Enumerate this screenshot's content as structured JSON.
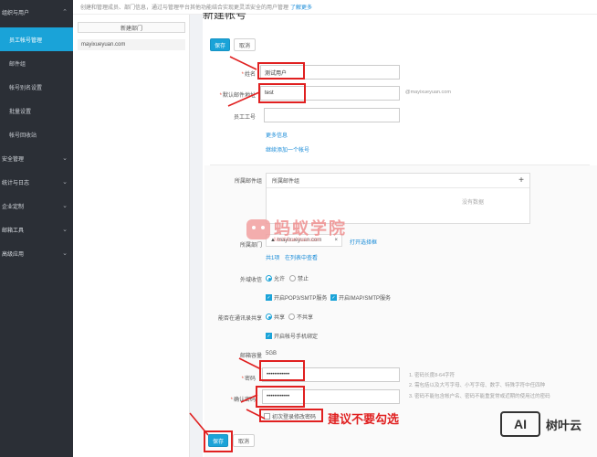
{
  "sidebar": {
    "groups": [
      {
        "label": "组织与用户"
      },
      {
        "label": "安全管理"
      },
      {
        "label": "统计与日志"
      },
      {
        "label": "企业定制"
      },
      {
        "label": "邮箱工具"
      },
      {
        "label": "高级应用"
      }
    ],
    "items": [
      {
        "label": "员工帐号管理",
        "active": true
      },
      {
        "label": "邮件组"
      },
      {
        "label": "帐号别名设置"
      },
      {
        "label": "批量设置"
      },
      {
        "label": "帐号回收站"
      }
    ]
  },
  "topbar": {
    "text": "创建和管理成员、部门信息，通过与管理平台其他功能结合实现更灵活安全的用户管理",
    "more_link": "了解更多"
  },
  "dept": {
    "new_button": "新建部门",
    "item": "mayixueyuan.com"
  },
  "form": {
    "heading": "新建帐号",
    "save": "保存",
    "cancel": "取消",
    "name_label": "姓名",
    "name_value": "测试用户",
    "email_label": "默认邮件地址",
    "email_value": "test",
    "email_domain": "@mayixueyuan.com",
    "empno_label": "员工工号",
    "more_info": "更多信息",
    "add_another": "继续添加一个帐号",
    "group_label": "所属邮件组",
    "group_box_header": "所属邮件组",
    "group_empty": "没有数据",
    "dept_label": "所属部门",
    "dept_tag": "mayixueyuan.com",
    "open_select": "打开选择框",
    "dept_count": "共1项",
    "view_in_list": "在列表中查看",
    "external_label": "外域收信",
    "allow": "允许",
    "forbid": "禁止",
    "pop3": "开启POP3/SMTP服务",
    "imap": "开启IMAP/SMTP服务",
    "addrbook_label": "能否在通讯录共享",
    "share": "共享",
    "no_share": "不共享",
    "phone_bind": "开启帐号手机绑定",
    "capacity_label": "邮箱容量",
    "capacity_value": "5GB",
    "password_label": "密码",
    "password_value": "••••••••••••",
    "confirm_label": "确认密码",
    "confirm_value": "••••••••••••",
    "first_login": "初次登录修改密码",
    "hint1": "1. 密码长度8-64字符",
    "hint2": "2. 需包括以及大写字母、小写字母、数字、特殊字符中任四种",
    "hint3": "3. 密码不能包含帐户名、密码不能重复常或近期的使用过的密码"
  },
  "annotation": "建议不要勾选",
  "watermark": {
    "title": "蚂蚁学院",
    "subtitle": "MaYiXueYuan.com"
  },
  "logo": {
    "mark": "AI",
    "name": "树叶云"
  },
  "colors": {
    "accent": "#1aa3d8",
    "sidebar": "#2b2f36",
    "annotation": "#e02020"
  }
}
